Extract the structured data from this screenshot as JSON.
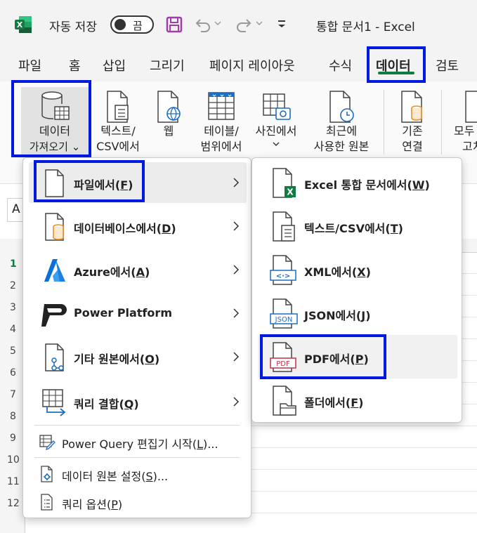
{
  "titlebar": {
    "autosave_label": "자동 저장",
    "autosave_state": "끔",
    "doc_title": "통합 문서1  -  Excel"
  },
  "tabs": [
    {
      "label": "파일"
    },
    {
      "label": "홈"
    },
    {
      "label": "삽입"
    },
    {
      "label": "그리기"
    },
    {
      "label": "페이지 레이아웃"
    },
    {
      "label": "수식"
    },
    {
      "label": "데이터",
      "active": true
    },
    {
      "label": "검토"
    }
  ],
  "ribbon": {
    "get_data": {
      "line1": "데이터",
      "line2": "가져오기"
    },
    "text_csv": {
      "line1": "텍스트/",
      "line2": "CSV에서"
    },
    "web": {
      "line1": "웹"
    },
    "table_range": {
      "line1": "테이블/",
      "line2": "범위에서"
    },
    "from_picture": {
      "line1": "사진에서"
    },
    "recent_sources": {
      "line1": "최근에",
      "line2": "사용한 원본"
    },
    "existing_conn": {
      "line1": "기존",
      "line2": "연결"
    },
    "refresh_all": {
      "line1": "모두",
      "line2": "고치"
    }
  },
  "namebox": {
    "value": "A"
  },
  "row_numbers": [
    "1",
    "2",
    "3",
    "4",
    "5",
    "6",
    "7",
    "8",
    "9",
    "10",
    "11",
    "12"
  ],
  "main_menu": {
    "items": [
      {
        "pre": "파일에서(",
        "key": "F",
        "post": ")",
        "icon": "file-icon"
      },
      {
        "pre": "데이터베이스에서(",
        "key": "D",
        "post": ")",
        "icon": "database-icon"
      },
      {
        "pre": "Azure에서(",
        "key": "A",
        "post": ")",
        "icon": "azure-icon"
      },
      {
        "pre": "Power Platform",
        "key": "",
        "post": "",
        "icon": "power-platform-icon"
      },
      {
        "pre": "기타 원본에서(",
        "key": "O",
        "post": ")",
        "icon": "other-sources-icon"
      },
      {
        "pre": "쿼리 결합(",
        "key": "Q",
        "post": ")",
        "icon": "combine-queries-icon"
      }
    ],
    "small_items": [
      {
        "pre": "Power Query 편집기 시작(",
        "key": "L",
        "post": ")...",
        "icon": "power-query-editor-icon"
      },
      {
        "pre": "데이터 원본 설정(",
        "key": "S",
        "post": ")...",
        "icon": "data-source-settings-icon"
      },
      {
        "pre": "쿼리 옵션(",
        "key": "P",
        "post": ")",
        "icon": "query-options-icon"
      }
    ]
  },
  "sub_menu": {
    "items": [
      {
        "pre": "Excel 통합 문서에서(",
        "key": "W",
        "post": ")",
        "icon": "excel-workbook-icon"
      },
      {
        "pre": "텍스트/CSV에서(",
        "key": "T",
        "post": ")",
        "icon": "text-csv-icon"
      },
      {
        "pre": "XML에서(",
        "key": "X",
        "post": ")",
        "icon": "xml-icon"
      },
      {
        "pre": "JSON에서(",
        "key": "J",
        "post": ")",
        "icon": "json-icon"
      },
      {
        "pre": "PDF에서(",
        "key": "P",
        "post": ")",
        "icon": "pdf-icon"
      },
      {
        "pre": "폴더에서(",
        "key": "F",
        "post": ")",
        "icon": "folder-icon"
      }
    ],
    "icon_text": {
      "xml": "<·>",
      "json": "JSON",
      "pdf": "PDF",
      "excel_x": "X"
    }
  },
  "colors": {
    "highlight": "#0019e0",
    "excel_green": "#107c41",
    "save_purple": "#a33ba8",
    "azure_blue": "#0a6fd6",
    "accent_blue": "#1b6ec2",
    "db_orange": "#e8912d"
  }
}
